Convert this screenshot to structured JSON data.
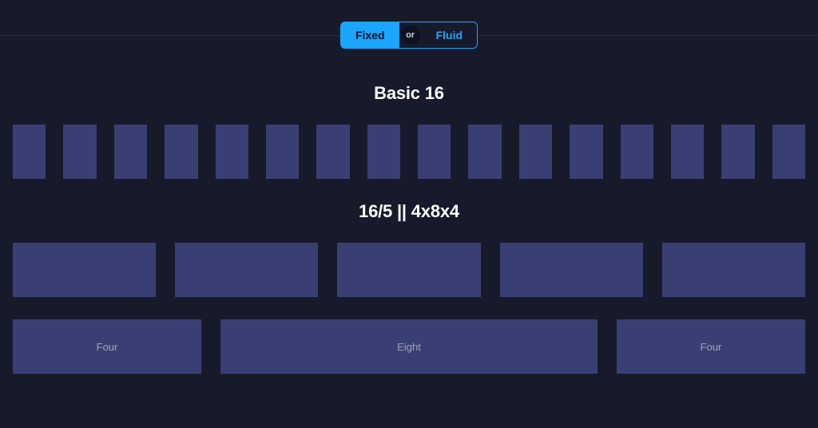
{
  "toggle": {
    "left_label": "Fixed",
    "or_label": "or",
    "right_label": "Fluid",
    "active": "left"
  },
  "sections": {
    "basic16_title": "Basic 16",
    "section2_title": "16/5 || 4x8x4"
  },
  "row_484": {
    "left_label": "Four",
    "center_label": "Eight",
    "right_label": "Four"
  },
  "colors": {
    "bg": "#171a2b",
    "accent": "#1aa5ff",
    "col": "#3a3f73"
  }
}
